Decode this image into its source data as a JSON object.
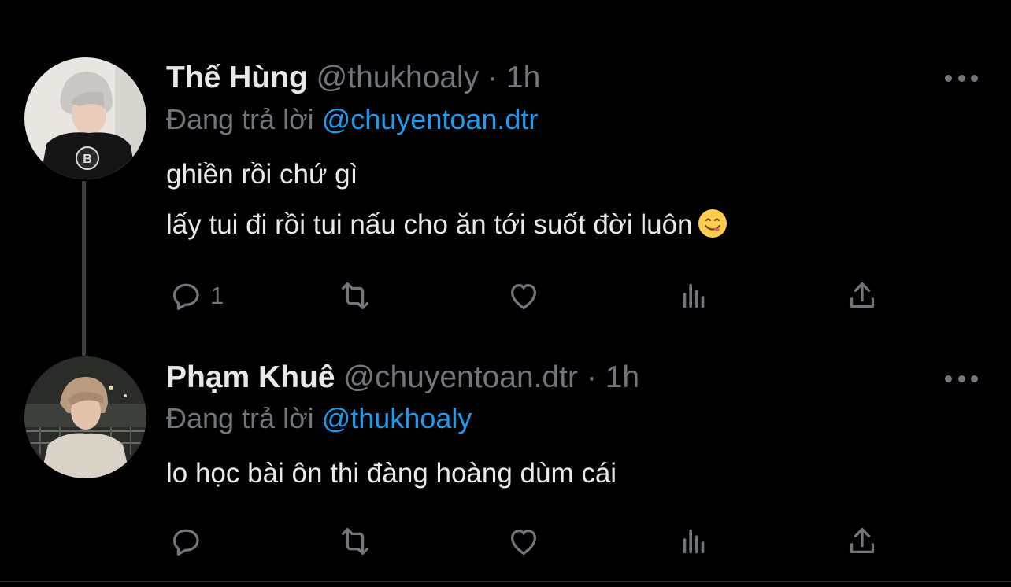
{
  "tweets": [
    {
      "author_name": "Thế Hùng",
      "handle": "@thukhoaly",
      "separator": "·",
      "time": "1h",
      "replying_label": "Đang trả lời",
      "replying_to": "@chuyentoan.dtr",
      "lines": [
        "ghiền rồi chứ gì",
        "lấy tui đi rồi tui nấu cho ăn tới suốt đời luôn"
      ],
      "emoji": "face-savoring-food",
      "reply_count": "1"
    },
    {
      "author_name": "Phạm Khuê",
      "handle": "@chuyentoan.dtr",
      "separator": "·",
      "time": "1h",
      "replying_label": "Đang trả lời",
      "replying_to": "@thukhoaly",
      "lines": [
        "lo học bài ôn thi đàng hoàng dùm cái"
      ],
      "reply_count": ""
    }
  ],
  "colors": {
    "background": "#000000",
    "text": "#e7e9ea",
    "muted": "#71767b",
    "accent": "#1d9bf0"
  },
  "icons": [
    "reply-icon",
    "retweet-icon",
    "like-icon",
    "views-icon",
    "share-icon",
    "more-icon"
  ]
}
